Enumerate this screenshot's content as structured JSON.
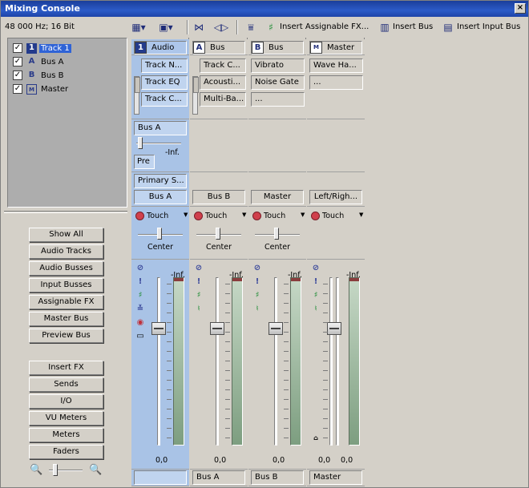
{
  "window": {
    "title": "Mixing Console",
    "close_icon": "close-icon"
  },
  "toolbar": {
    "format": "48 000 Hz; 16 Bit",
    "insert_assignable_fx": "Insert Assignable FX...",
    "insert_bus": "Insert Bus",
    "insert_input_bus": "Insert Input Bus"
  },
  "tracklist": [
    {
      "checked": true,
      "icon_text": "1",
      "label": "Track 1",
      "selected": true
    },
    {
      "checked": true,
      "icon_text": "A",
      "label": "Bus A",
      "selected": false
    },
    {
      "checked": true,
      "icon_text": "B",
      "label": "Bus B",
      "selected": false
    },
    {
      "checked": true,
      "icon_text": "M",
      "label": "Master",
      "selected": false
    }
  ],
  "view_buttons": [
    "Show All",
    "Audio Tracks",
    "Audio Busses",
    "Input Busses",
    "Assignable FX",
    "Master Bus",
    "Preview Bus"
  ],
  "section_buttons": [
    "Insert FX",
    "Sends",
    "I/O",
    "VU Meters",
    "Meters",
    "Faders"
  ],
  "strips": [
    {
      "header_icon": "1",
      "header_label": "Audio",
      "fx": [
        "Track N...",
        "Track EQ",
        "Track C..."
      ],
      "send_name": "Bus A",
      "send_pre": "Pre",
      "send_value": "-Inf.",
      "input": "Primary S...",
      "output": "Bus A",
      "automation": "Touch",
      "pan": "Center",
      "peak": "-Inf.",
      "values": [
        "0,0"
      ],
      "footer": ""
    },
    {
      "header_icon": "A",
      "header_label": "Bus",
      "fx": [
        "Track C...",
        "Acousti...",
        "Multi-Ba..."
      ],
      "output": "Bus B",
      "automation": "Touch",
      "pan": "Center",
      "peak": "-Inf.",
      "values": [
        "0,0"
      ],
      "footer": "Bus A"
    },
    {
      "header_icon": "B",
      "header_label": "Bus",
      "fx": [
        "Vibrato",
        "Noise Gate",
        "..."
      ],
      "output": "Master",
      "automation": "Touch",
      "pan": "Center",
      "peak": "-Inf.",
      "values": [
        "0,0"
      ],
      "footer": "Bus B"
    },
    {
      "header_icon": "M",
      "header_label": "Master",
      "fx": [
        "Wave Ha...",
        "..."
      ],
      "output": "Left/Righ...",
      "automation": "Touch",
      "peak": "-Inf.",
      "values": [
        "0,0",
        "0,0"
      ],
      "footer": "Master"
    }
  ]
}
